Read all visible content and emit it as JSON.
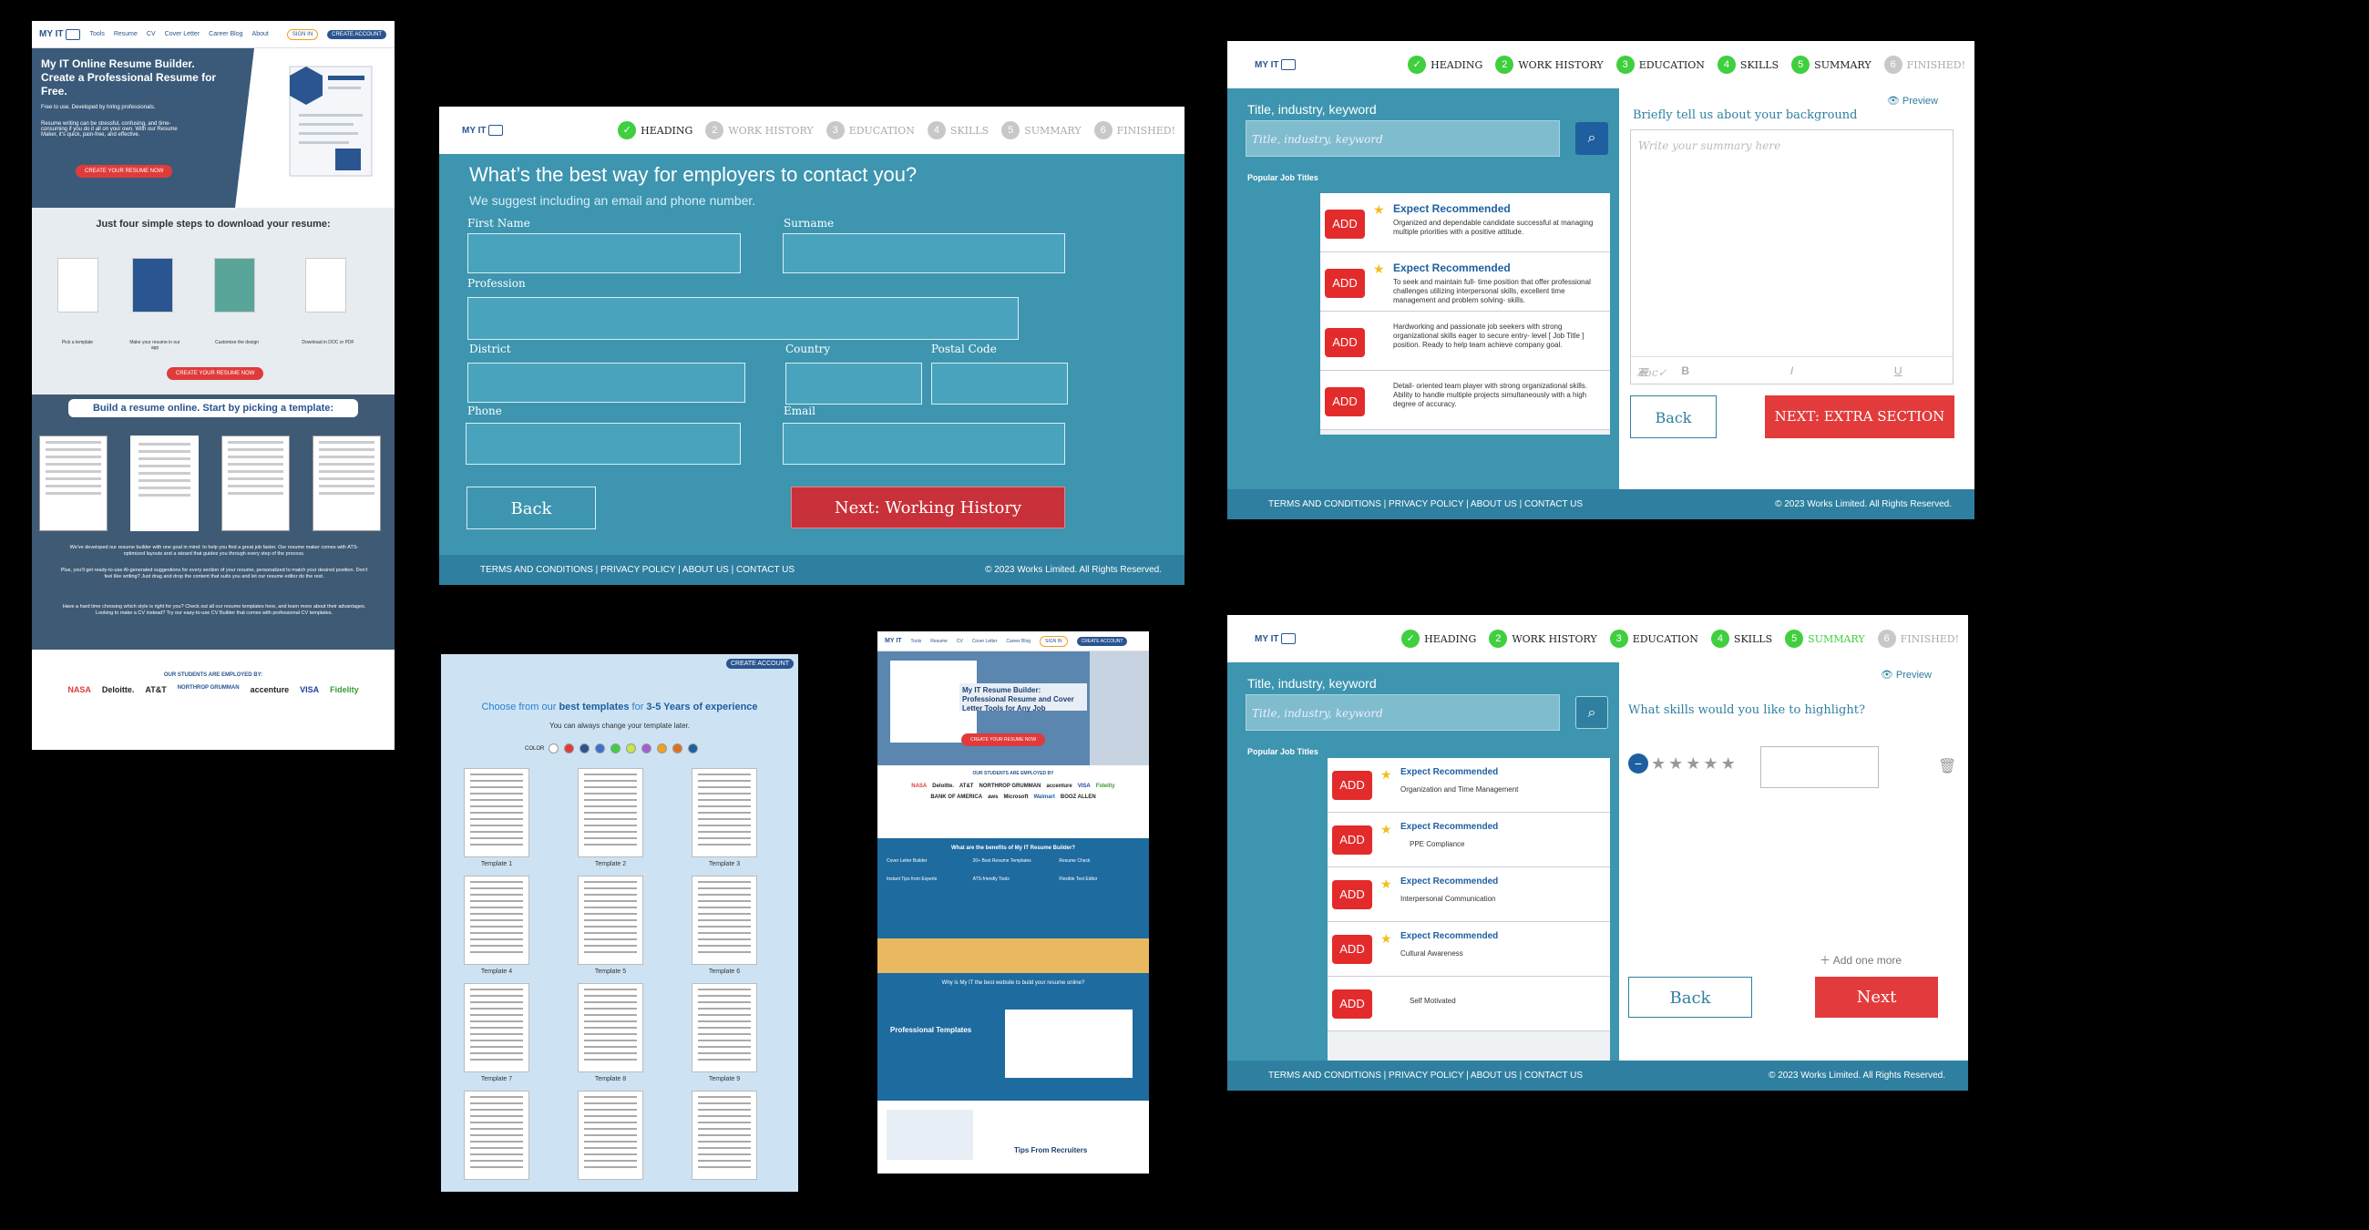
{
  "landing": {
    "nav": [
      "Tools",
      "Resume",
      "CV",
      "Cover Letter",
      "Career Blog",
      "About"
    ],
    "signin": "SIGN IN",
    "create": "CREATE ACCOUNT",
    "logo": "MY IT",
    "hero_title": "My IT Online Resume Builder. Create a Professional Resume for Free.",
    "hero_tag": "Free to use. Developed by hiring professionals.",
    "hero_text": "Resume writing can be stressful, confusing, and time-consuming if you do it all on your own. With our Resume Maker, it's quick, pain-free, and effective.",
    "hero_btn": "CREATE YOUR RESUME NOW",
    "steps_title": "Just four simple steps to download your resume:",
    "steps": [
      "Pick a template",
      "Make your resume in our app",
      "Customize the design",
      "Download in DOC or PDF"
    ],
    "steps_btn": "CREATE YOUR RESUME NOW",
    "tpl_title": "Build a resume online. Start by picking a template:",
    "p1": "We've developed our resume builder with one goal in mind: to help you find a great job faster. Our resume maker comes with ATS-optimized layouts and a wizard that guides you through every step of the process.",
    "p2": "Plus, you'll get ready-to-use AI-generated suggestions for every section of your resume, personalized to match your desired position. Don't feel like writing? Just drag and drop the content that suits you and let our resume editor do the rest.",
    "p3": "Have a hard time choosing which style is right for you? Check out all our resume templates here, and learn more about their advantages. Looking to make a CV instead? Try our easy-to-use CV Builder that comes with professional CV templates.",
    "employ": "OUR STUDENTS ARE EMPLOYED BY:",
    "logos": [
      "NASA",
      "Deloitte.",
      "AT&T",
      "NORTHROP GRUMMAN",
      "accenture",
      "VISA",
      "Fidelity"
    ]
  },
  "contact": {
    "steps": [
      "HEADING",
      "WORK HISTORY",
      "EDUCATION",
      "SKILLS",
      "SUMMARY",
      "FINISHED!"
    ],
    "question": "What’s the best way for employers to contact you?",
    "sub": "We suggest including an email and phone number.",
    "labels": {
      "first": "First Name",
      "surname": "Surname",
      "profession": "Profession",
      "district": "District",
      "country": "Country",
      "postal": "Postal Code",
      "phone": "Phone",
      "email": "Email"
    },
    "back": "Back",
    "next": "Next: Working History",
    "footer_links": "TERMS AND CONDITIONS | PRIVACY POLICY | ABOUT US | CONTACT US",
    "copyright": "© 2023 Works Limited. All Rights Reserved."
  },
  "summary": {
    "steps": [
      "HEADING",
      "WORK HISTORY",
      "EDUCATION",
      "SKILLS",
      "SUMMARY",
      "FINISHED!"
    ],
    "kw_label": "Title, industry, keyword",
    "kw_ph": "Title, industry, keyword",
    "popular": "Popular Job Titles",
    "add": "ADD",
    "rows": [
      {
        "title": "Expect Recommended",
        "desc": "Organized and dependable candidate successful at managing multiple priorities with a positive attitude."
      },
      {
        "title": "Expect Recommended",
        "desc": "To seek and maintain full- time position that offer professional challenges utilizing interpersonal skills, excellent time management and problem solving- skills."
      },
      {
        "title": "",
        "desc": "Hardworking and passionate job seekers with strong organizational skills eager to secure entry- level [ Job Title ] position. Ready to help team achieve company goal."
      },
      {
        "title": "",
        "desc": "Detail- oriented team player with strong organizational skills. Ability to handle multiple projects simultaneously with a high degree of accuracy."
      }
    ],
    "preview": "Preview",
    "hint": "Briefly tell us about your background",
    "ta_ph": "Write your summary here",
    "back": "Back",
    "next": "NEXT: EXTRA SECTION",
    "footer_links": "TERMS AND CONDITIONS | PRIVACY POLICY | ABOUT US | CONTACT US",
    "copyright": "© 2023 Works Limited. All Rights Reserved."
  },
  "templates": {
    "create": "CREATE ACCOUNT",
    "title_a": "Choose from our ",
    "title_b": "best templates",
    "title_c": " for ",
    "title_d": "3-5 Years of experience",
    "sub": "You can always change your template later.",
    "color": "COLOR",
    "swatches": [
      "#ffffff",
      "#e03b3b",
      "#2a5590",
      "#3b6fd0",
      "#3fcf3f",
      "#c8e64a",
      "#a060d0",
      "#f0a020",
      "#e07020",
      "#1e5fa0"
    ],
    "names": [
      "Template 1",
      "Template 2",
      "Template 3",
      "Template 4",
      "Template 5",
      "Template 6",
      "Template 7",
      "Template 8",
      "Template 9"
    ]
  },
  "landing2": {
    "hero_title": "My IT Resume Builder: Professional Resume and Cover Letter Tools for Any Job",
    "employ": "OUR STUDENTS ARE EMPLOYED BY",
    "benefits": "What are the benefits of My IT Resume Builder?",
    "feat": [
      "Cover Letter Builder",
      "20+ Best Resume Templates",
      "Resume Check",
      "Instant Tips from Experts",
      "ATS-friendly Tools",
      "Flexible Text Editor"
    ],
    "why": "Why is My IT the best website to build your resume online?",
    "pro": "Professional Templates",
    "tips": "Tips From Recruiters",
    "logos": [
      "NASA",
      "Deloitte.",
      "AT&T",
      "NORTHROP GRUMMAN",
      "accenture",
      "VISA",
      "Fidelity",
      "BANK OF AMERICA",
      "aws",
      "Microsoft",
      "Walmart",
      "BOOZ ALLEN"
    ]
  },
  "skills": {
    "steps": [
      "HEADING",
      "WORK HISTORY",
      "EDUCATION",
      "SKILLS",
      "SUMMARY",
      "FINISHED!"
    ],
    "kw_label": "Title, industry, keyword",
    "kw_ph": "Title, industry, keyword",
    "popular": "Popular Job Titles",
    "add": "ADD",
    "rows": [
      {
        "title": "Expect Recommended",
        "desc": "Organization and Time Management"
      },
      {
        "title": "Expect Recommended",
        "desc": "PPE Compliance"
      },
      {
        "title": "Expect Recommended",
        "desc": "Interpersonal Communication"
      },
      {
        "title": "Expect Recommended",
        "desc": "Cultural Awareness"
      },
      {
        "title": "",
        "desc": "Self Motivated"
      }
    ],
    "preview": "Preview",
    "hint": "What skills would you like to highlight?",
    "add_more": "Add one more",
    "back": "Back",
    "next": "Next",
    "footer_links": "TERMS AND CONDITIONS | PRIVACY POLICY | ABOUT US | CONTACT US",
    "copyright": "© 2023 Works Limited. All Rights Reserved."
  }
}
